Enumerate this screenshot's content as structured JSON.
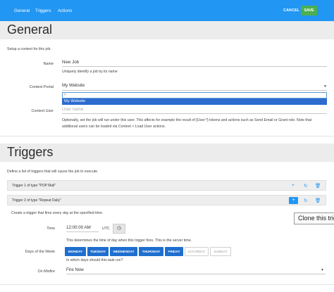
{
  "topbar": {
    "nav": [
      "General",
      "Triggers",
      "Actions"
    ],
    "cancel_label": "CANCEL",
    "save_label": "SAVE",
    "bg_color": "#2196f3",
    "save_color": "#4caf50"
  },
  "general": {
    "title": "General",
    "intro": "Setup a context for this job.",
    "name_label": "Name",
    "name_value": "New Job",
    "name_help": "Uniquely identify a job by its name",
    "context_portal_label": "Context Portal",
    "context_portal_value": "My Website",
    "dropdown_search_value": "×",
    "dropdown_selected": "My Website",
    "context_user_label": "Context User",
    "context_user_placeholder": "User name",
    "context_user_help_1": "Optionally, set the job will run under this user. This affects for example the result of [User:*] tokens and actions such as Send Email or Grant role. Note that",
    "context_user_help_2": "additional users can be loaded via Context > Load User actions."
  },
  "triggers": {
    "title": "Triggers",
    "intro": "Define a list of triggers that will cause the job to execute.",
    "trigger1_title": "Trigger 1 of type \"POP Mail\"",
    "trigger2_title": "Trigger 2 of type \"Repeat Daily\"",
    "trigger2_desc": "Create a trigger that fires every day at the specified time.",
    "time_label": "Time",
    "time_value": "12:00:00 AM",
    "time_zone": "UTC",
    "time_help": "This determines the time of day when this trigger fires. This is the server time.",
    "days_label": "Days of the Week",
    "days": [
      {
        "label": "MONDAY",
        "on": true
      },
      {
        "label": "TUESDAY",
        "on": true
      },
      {
        "label": "WEDNESDAY",
        "on": true
      },
      {
        "label": "THURSDAY",
        "on": true
      },
      {
        "label": "FRIDAY",
        "on": true
      },
      {
        "label": "SATURDAY",
        "on": false
      },
      {
        "label": "SUNDAY",
        "on": false
      }
    ],
    "days_help": "In which days should this task run?",
    "onmisfire_label": "On Misfire",
    "onmisfire_value": "Fire Now",
    "tooltip": "Clone this trigger"
  },
  "icons": {
    "add": "plus-icon",
    "refresh": "refresh-icon",
    "delete": "trash-icon",
    "clock": "clock-icon"
  }
}
